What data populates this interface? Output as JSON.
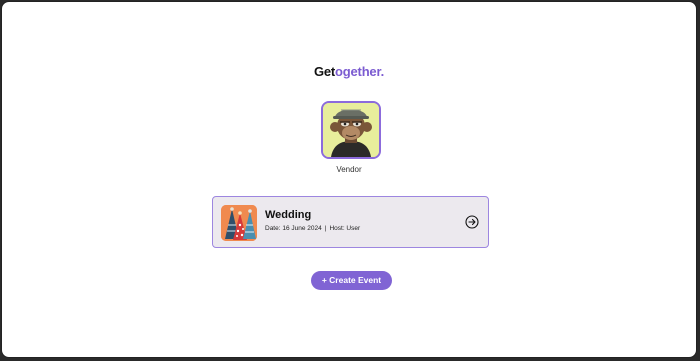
{
  "brand": {
    "prefix": "Get",
    "suffix": "ogether."
  },
  "profile": {
    "role_label": "Vendor"
  },
  "event": {
    "title": "Wedding",
    "date_label": "Date: 16 June 2024",
    "separator": "|",
    "host_label": "Host: User"
  },
  "actions": {
    "create_event_label": "+ Create Event"
  },
  "colors": {
    "accent": "#7b5bd1",
    "button": "#8064d4",
    "card_bg": "#ece9ee",
    "avatar_bg": "#e8ee9c"
  },
  "icons": {
    "event_open": "arrow-right-circle-icon",
    "event_thumbnail": "party-hats-icon",
    "avatar": "ape-avatar-icon"
  }
}
